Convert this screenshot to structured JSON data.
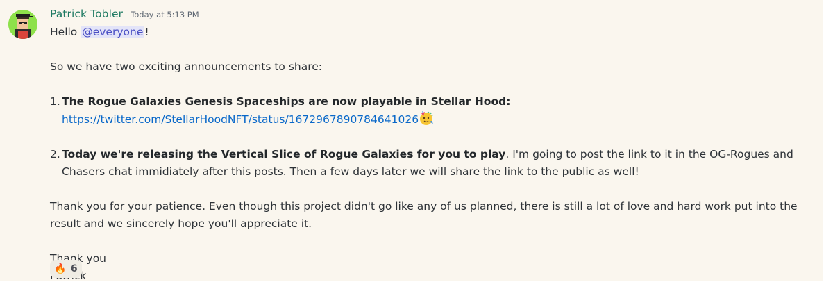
{
  "message": {
    "author": "Patrick Tobler",
    "timestamp": "Today at 5:13 PM",
    "greeting_prefix": "Hello ",
    "mention": "@everyone",
    "greeting_suffix": "!",
    "intro": "So we have two exciting announcements to share:",
    "items": [
      {
        "number": "1.",
        "bold": "The Rogue Galaxies Genesis Spaceships are now playable in Stellar Hood:",
        "link": "https://twitter.com/StellarHoodNFT/status/1672967890784641026",
        "emoji": "party-face-emoji"
      },
      {
        "number": "2.",
        "bold": "Today we're releasing the Vertical Slice of Rogue Galaxies for you to play",
        "text": ". I'm going to post the link to it in the OG-Rogues and Chasers chat immidiately after this posts. Then a few days later we will share the link to the public as well!"
      }
    ],
    "thanks_paragraph": "Thank you for your patience. Even though this project didn't go like any of us planned, there is still a lot of love and hard work put into the result and we sincerely hope you'll appreciate it.",
    "signoff_line1": "Thank you",
    "signoff_line2": "Patrick",
    "reaction": {
      "emoji": "🔥",
      "count": "6"
    }
  },
  "colors": {
    "message_bg": "#faf6ee",
    "author": "#1f7a63",
    "link": "#0968c9",
    "mention_bg": "#e3e4f8",
    "mention_text": "#4a4fc4",
    "avatar_bg": "#8ee14b"
  }
}
